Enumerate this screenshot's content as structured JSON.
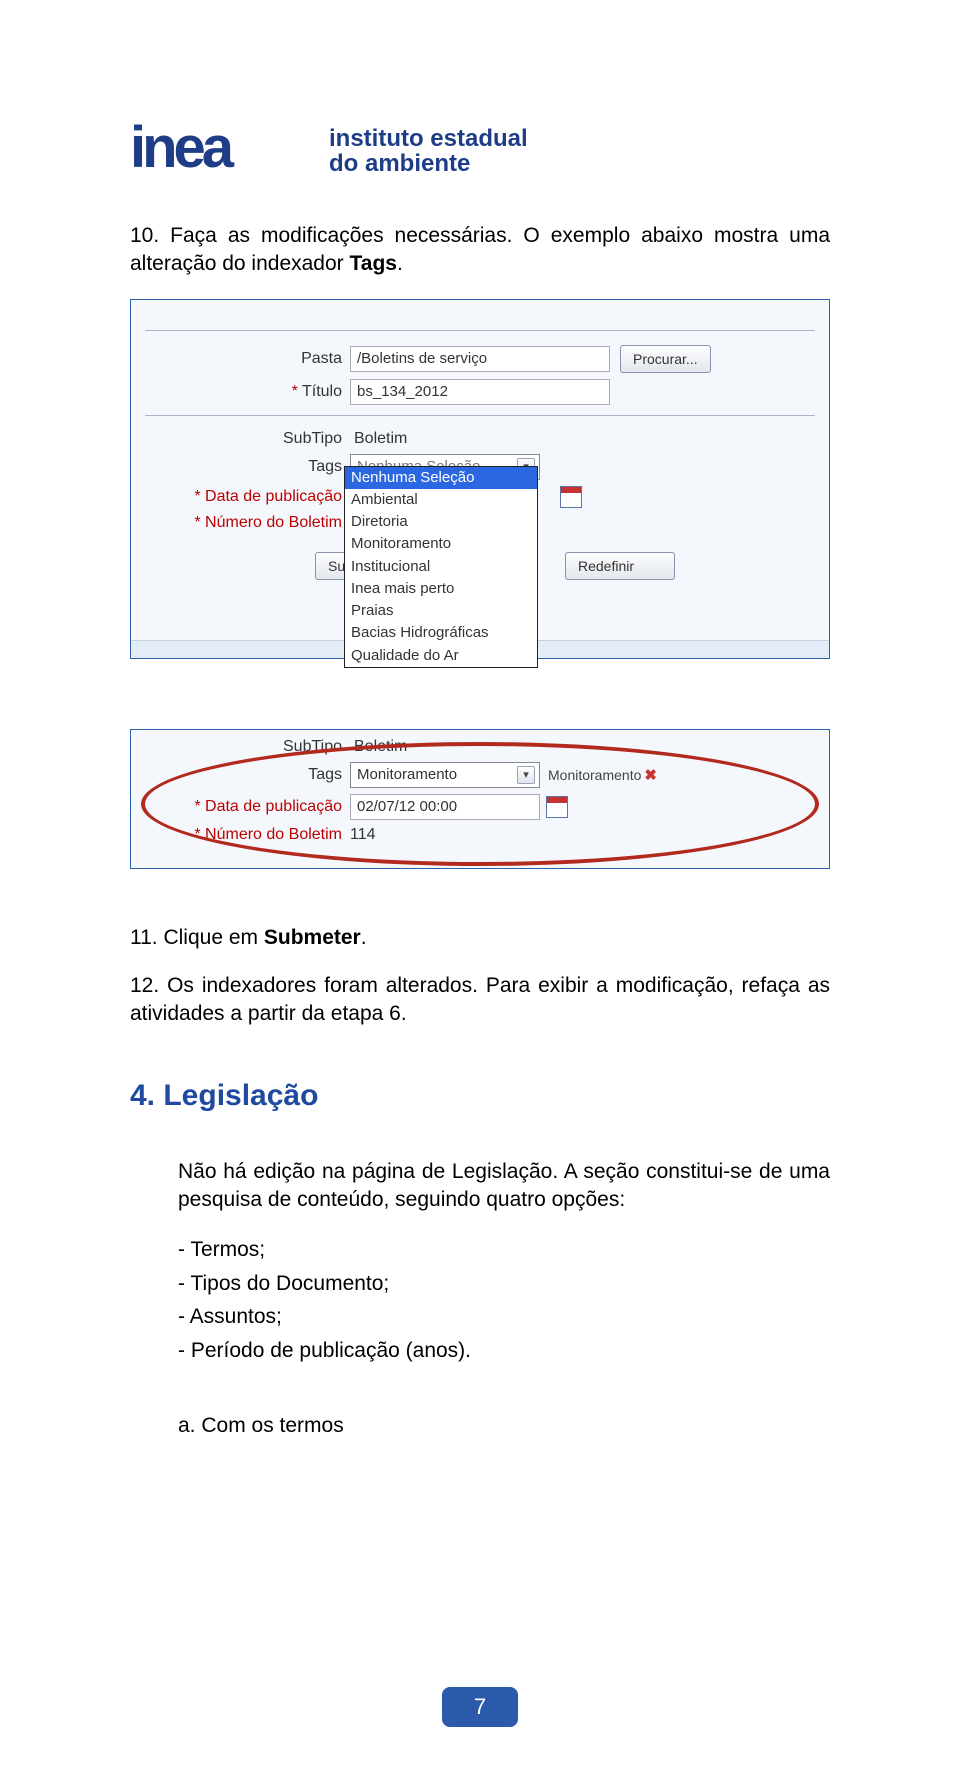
{
  "logo": {
    "word": "inea",
    "line1": "instituto estadual",
    "line2": "do ambiente"
  },
  "step10": {
    "prefix": "10. Faça as modificações necessárias. O exemplo abaixo mostra uma alteração do indexador ",
    "bold": "Tags",
    "suffix": "."
  },
  "panel1": {
    "pasta_lbl": "Pasta",
    "pasta_val": "/Boletins de serviço",
    "procurar": "Procurar...",
    "titulo_lbl": "* Título",
    "titulo_val": "bs_134_2012",
    "subtipo_lbl": "SubTipo",
    "subtipo_val": "Boletim",
    "tags_lbl": "Tags",
    "tags_ph": "Nenhuma Seleção",
    "data_lbl": "* Data de publicação",
    "num_lbl": "* Número do Boletim",
    "btn_sub": "Subi",
    "btn_redef": "Redefinir",
    "options": [
      "Nenhuma Seleção",
      "Ambiental",
      "Diretoria",
      "Monitoramento",
      "Institucional",
      "Inea mais perto",
      "Praias",
      "Bacias Hidrográficas",
      "Qualidade do Ar"
    ]
  },
  "panel2": {
    "subtipo_lbl": "SubTipo",
    "subtipo_val": "Boletim",
    "tags_lbl": "Tags",
    "tags_val": "Monitoramento",
    "chip": "Monitoramento",
    "data_lbl": "* Data de publicação",
    "data_val": "02/07/12 00:00",
    "num_lbl": "* Número do Boletim",
    "num_val": "114"
  },
  "step11": {
    "prefix": "11. Clique em ",
    "bold": "Submeter",
    "suffix": "."
  },
  "step12": "12. Os indexadores foram alterados. Para exibir a modificação, refaça as atividades a partir da etapa 6.",
  "section": "4. Legislação",
  "legis_para": "Não há edição na página de Legislação. A seção constitui-se de uma pesquisa de conteúdo, seguindo quatro opções:",
  "bullets": [
    "- Termos;",
    "- Tipos do Documento;",
    "- Assuntos;",
    "- Período de publicação (anos)."
  ],
  "sub_a": "a.   Com os termos",
  "pagenum": "7"
}
